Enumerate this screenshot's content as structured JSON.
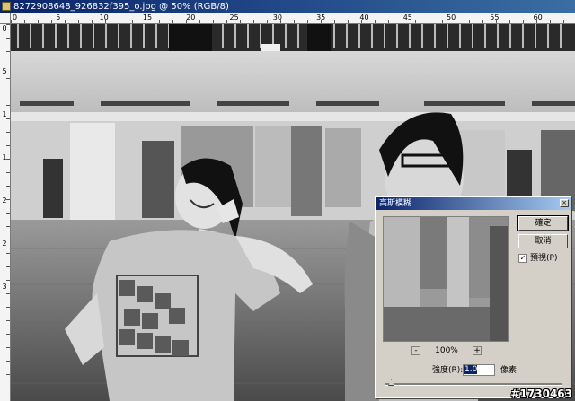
{
  "window": {
    "title": "8272908648_926832f395_o.jpg @ 50% (RGB/8)"
  },
  "rulers": {
    "top_labels": [
      "0",
      "5",
      "10",
      "15",
      "20",
      "25",
      "30",
      "35",
      "40",
      "45",
      "50",
      "55",
      "60"
    ],
    "left_labels": [
      "0",
      "5",
      "1",
      "1",
      "2",
      "2",
      "3"
    ]
  },
  "dialog": {
    "title": "高斯模糊",
    "close_glyph": "×",
    "ok_label": "確定",
    "cancel_label": "取消",
    "preview_label": "預視(P)",
    "preview_checked": true,
    "check_glyph": "✓",
    "zoom_minus": "-",
    "zoom_plus": "+",
    "zoom_level": "100%",
    "radius_label": "強度(R):",
    "radius_value": "1.0",
    "radius_unit": "像素",
    "radius_slider_fraction": 0.02
  },
  "watermark": "#1730463"
}
